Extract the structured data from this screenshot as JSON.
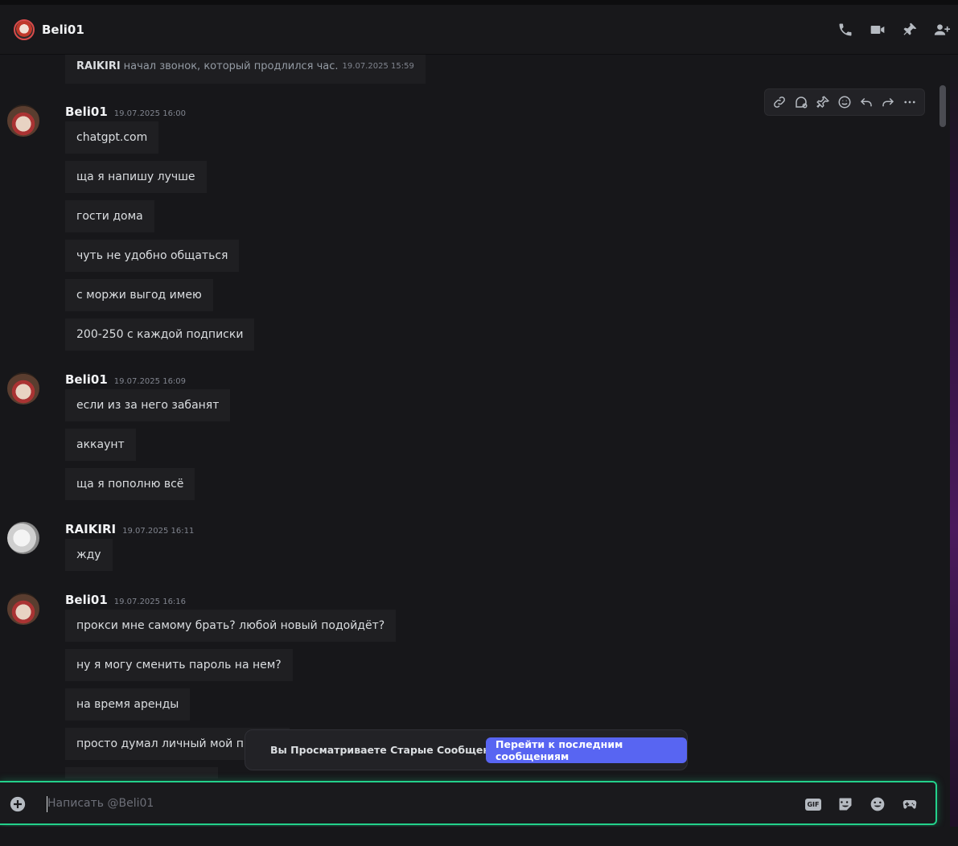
{
  "header": {
    "title": "Beli01",
    "icons": [
      "phone-call-icon",
      "video-call-icon",
      "pin-icon",
      "add-member-icon"
    ]
  },
  "system_message": {
    "user": "RAIKIRI",
    "text": "начал звонок, который продлился час.",
    "time": "19.07.2025 15:59"
  },
  "toolbar_icons": [
    "copy-link-icon",
    "mark-unread-icon",
    "pin-icon",
    "add-reaction-icon",
    "reply-icon",
    "forward-icon",
    "more-icon"
  ],
  "groups": [
    {
      "user": "Beli01",
      "time": "19.07.2025 16:00",
      "messages": [
        "chatgpt.com",
        "ща я напишу лучше",
        "гости дома",
        "чуть не удобно общаться",
        "с моржи выгод имею",
        "200-250 с каждой подписки"
      ]
    },
    {
      "user": "Beli01",
      "time": "19.07.2025 16:09",
      "messages": [
        "если из за него забанят",
        "аккаунт",
        "ща я пополню всё"
      ]
    },
    {
      "user": "RAIKIRI",
      "time": "19.07.2025 16:11",
      "messages": [
        "жду"
      ]
    },
    {
      "user": "Beli01",
      "time": "19.07.2025 16:16",
      "messages": [
        "прокси мне самому брать? любой новый подойдёт?",
        "ну я могу сменить пароль на нем?",
        "на время аренды",
        "просто думал личный мой прокси"
      ]
    }
  ],
  "old_messages_bar": {
    "label": "Вы Просматриваете Старые Сообщения",
    "jump_button": "Перейти к последним сообщениям"
  },
  "composer": {
    "placeholder": "Написать @Beli01",
    "icons": [
      "attach-plus-icon",
      "gif-icon",
      "sticker-icon",
      "emoji-icon",
      "activity-gamepad-icon"
    ]
  }
}
